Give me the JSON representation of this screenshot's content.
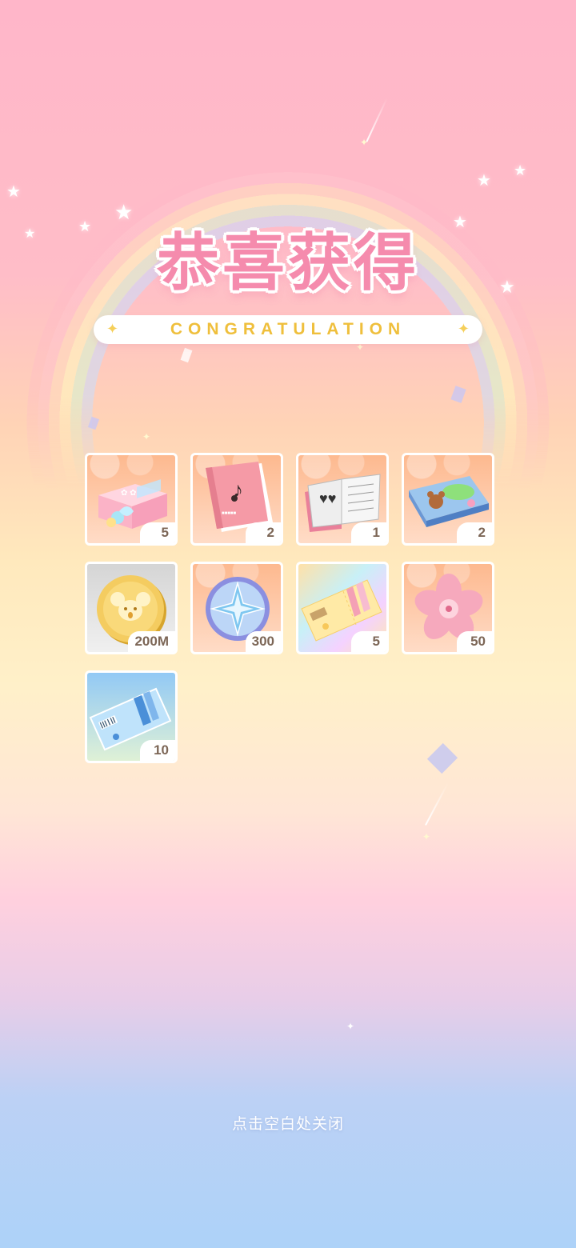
{
  "title": "恭喜获得",
  "subtitle": "CONGRATULATION",
  "rewards": [
    {
      "icon": "gift-box-icon",
      "quantity": "5"
    },
    {
      "icon": "music-book-icon",
      "quantity": "2"
    },
    {
      "icon": "open-book-icon",
      "quantity": "1"
    },
    {
      "icon": "bear-puzzle-box-icon",
      "quantity": "2"
    },
    {
      "icon": "gold-coin-icon",
      "quantity": "200M"
    },
    {
      "icon": "star-crystal-coin-icon",
      "quantity": "300"
    },
    {
      "icon": "rainbow-ticket-icon",
      "quantity": "5"
    },
    {
      "icon": "sakura-flower-icon",
      "quantity": "50"
    },
    {
      "icon": "blue-ticket-icon",
      "quantity": "10"
    }
  ],
  "close_hint": "点击空白处关闭"
}
